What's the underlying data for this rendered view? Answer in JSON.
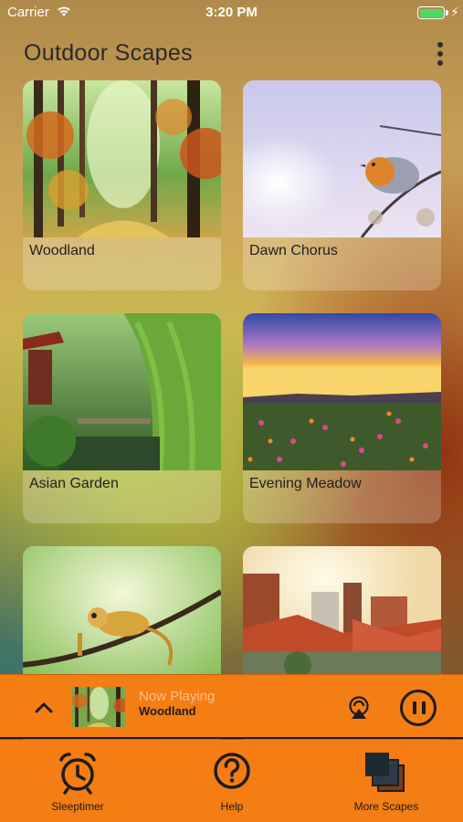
{
  "status_bar": {
    "carrier": "Carrier",
    "time": "3:20 PM"
  },
  "header": {
    "title": "Outdoor Scapes"
  },
  "scapes": [
    {
      "label": "Woodland"
    },
    {
      "label": "Dawn Chorus"
    },
    {
      "label": "Asian Garden"
    },
    {
      "label": "Evening Meadow"
    },
    {
      "label": ""
    },
    {
      "label": ""
    }
  ],
  "now_playing": {
    "status": "Now Playing",
    "title": "Woodland"
  },
  "tab_bar": {
    "items": [
      {
        "label": "Sleeptimer",
        "icon": "alarm-clock-icon"
      },
      {
        "label": "Help",
        "icon": "question-circle-icon"
      },
      {
        "label": "More Scapes",
        "icon": "stacked-squares-icon"
      }
    ]
  },
  "colors": {
    "accent": "#f47d14",
    "dark": "#1c1c1c",
    "battery": "#4cd964"
  }
}
